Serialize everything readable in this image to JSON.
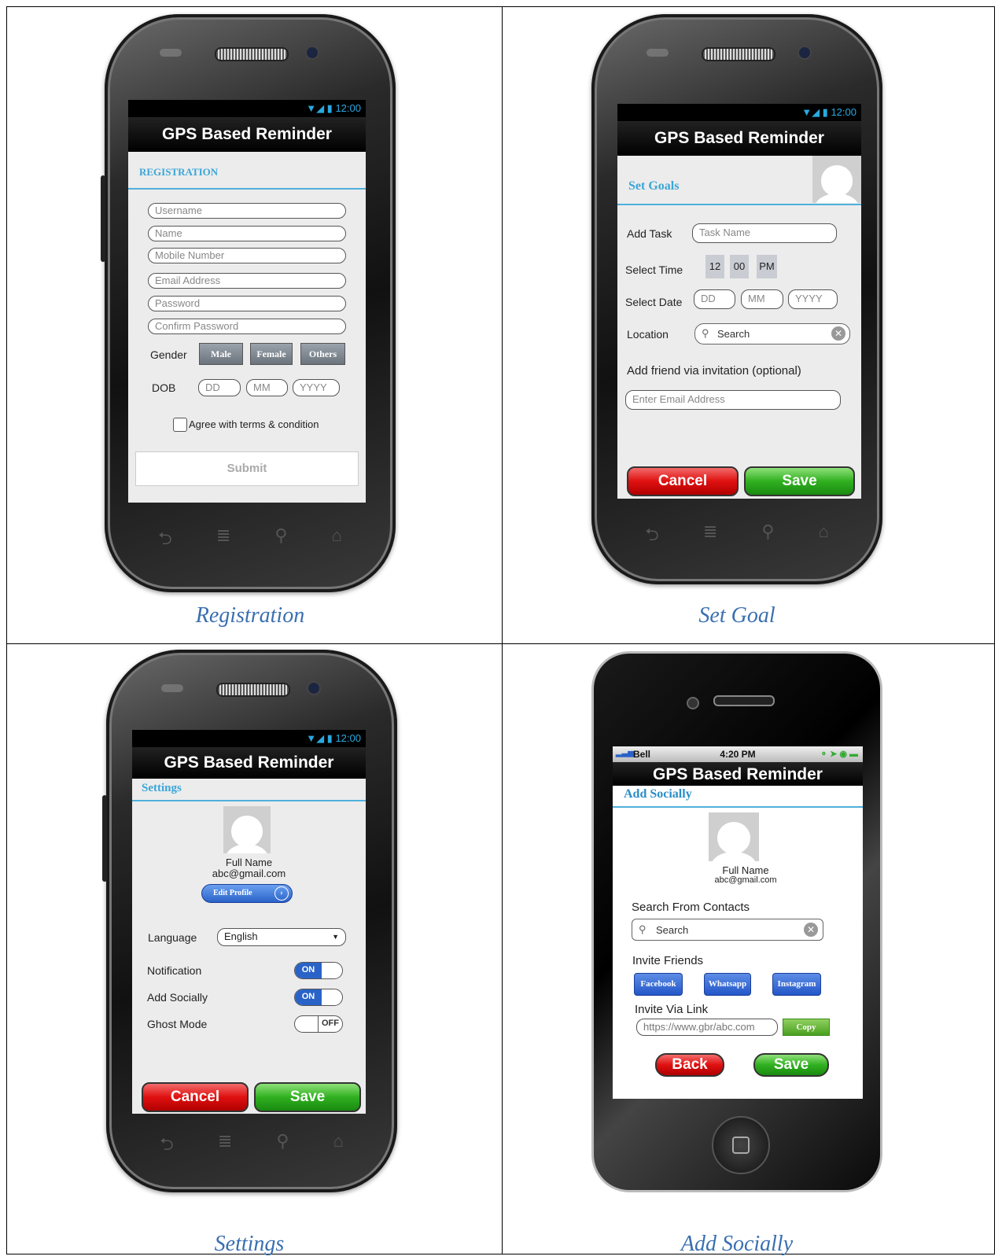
{
  "captions": {
    "registration": "Registration",
    "set_goal": "Set Goal",
    "settings": "Settings",
    "add_socially": "Add Socially"
  },
  "status": {
    "time": "12:00",
    "icons": "wifi-signal-battery"
  },
  "app_title": "GPS Based Reminder",
  "registration": {
    "section": "REGISTRATION",
    "fields": {
      "username": "Username",
      "name": "Name",
      "mobile": "Mobile Number",
      "email": "Email Address",
      "password": "Password",
      "confirm": "Confirm Password"
    },
    "gender_label": "Gender",
    "gender_options": {
      "male": "Male",
      "female": "Female",
      "others": "Others"
    },
    "dob_label": "DOB",
    "dob": {
      "dd": "DD",
      "mm": "MM",
      "yyyy": "YYYY"
    },
    "terms": "Agree with terms & condition",
    "submit": "Submit"
  },
  "set_goals": {
    "section": "Set Goals",
    "add_task_label": "Add Task",
    "task_placeholder": "Task Name",
    "select_time_label": "Select Time",
    "time": {
      "hour": "12",
      "minute": "00",
      "ampm": "PM"
    },
    "select_date_label": "Select Date",
    "date": {
      "dd": "DD",
      "mm": "MM",
      "yyyy": "YYYY"
    },
    "location_label": "Location",
    "search_placeholder": "Search",
    "invite_label": "Add friend via invitation (optional)",
    "email_placeholder": "Enter Email Address",
    "cancel": "Cancel",
    "save": "Save"
  },
  "settings": {
    "section": "Settings",
    "full_name": "Full Name",
    "email": "abc@gmail.com",
    "edit_profile": "Edit Profile",
    "language_label": "Language",
    "language_value": "English",
    "notification_label": "Notification",
    "notification_state": "ON",
    "add_socially_label": "Add Socially",
    "add_socially_state": "ON",
    "ghost_label": "Ghost Mode",
    "ghost_state": "OFF",
    "cancel": "Cancel",
    "save": "Save"
  },
  "add_socially": {
    "carrier": "Bell",
    "time": "4:20 PM",
    "section": "Add Socially",
    "full_name": "Full Name",
    "email": "abc@gmail.com",
    "search_contacts_label": "Search From Contacts",
    "search_placeholder": "Search",
    "invite_friends_label": "Invite Friends",
    "facebook": "Facebook",
    "whatsapp": "Whatsapp",
    "instagram": "Instagram",
    "invite_link_label": "Invite Via Link",
    "link": "https://www.gbr/abc.com",
    "copy": "Copy",
    "back": "Back",
    "save": "Save"
  }
}
